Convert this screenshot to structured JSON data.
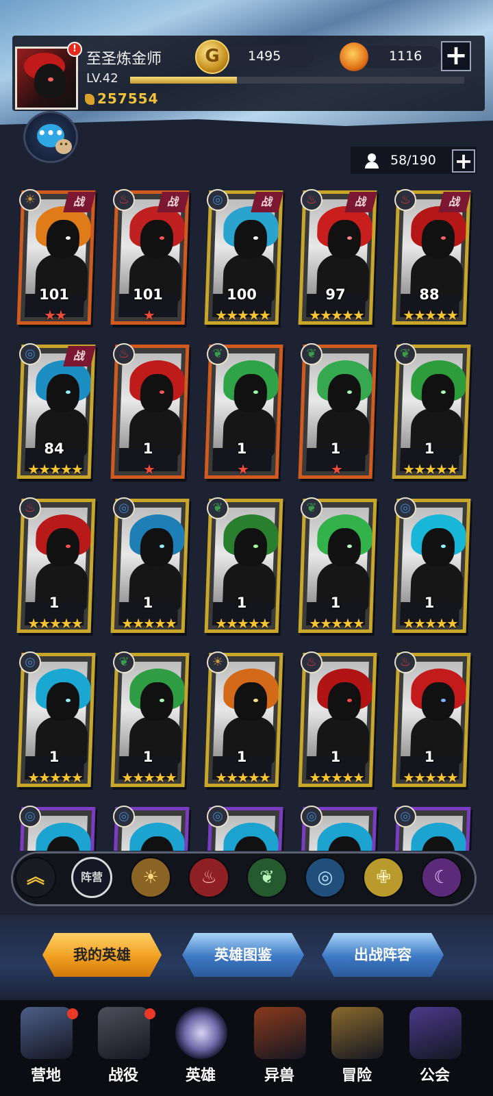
{
  "player": {
    "name": "至圣炼金师",
    "level": "LV.42",
    "power": "257554",
    "alert": "!",
    "xp_fraction": 0.32
  },
  "currency": {
    "gold_icon": "gold-coin-icon",
    "gold": "1495",
    "gem_icon": "fire-gem-icon",
    "gem": "1116",
    "add": "+"
  },
  "chat": {
    "icon": "chat-bubble-icon",
    "bubble": "•••",
    "small": "••"
  },
  "roster": {
    "count": "58/190",
    "add": "+"
  },
  "colors": {
    "gold_frame": "#c8a62a",
    "orange_frame": "#d15a1e",
    "purple_frame": "#7a3cc2",
    "star_gold": "#f6c531",
    "star_red": "#ef4d3c",
    "fight_tag": "#7b1730"
  },
  "heroes": [
    {
      "level": "101",
      "stars": "★★",
      "star_color": "red",
      "faction": "sun",
      "fight": "战",
      "frame": "orange",
      "hair": "#e07b1a",
      "eye": "#ffffff"
    },
    {
      "level": "101",
      "stars": "★",
      "star_color": "red",
      "faction": "fire",
      "fight": "战",
      "frame": "orange",
      "hair": "#c12020",
      "eye": "#ff5555"
    },
    {
      "level": "100",
      "stars": "★★★★★",
      "star_color": "gold",
      "faction": "water",
      "fight": "战",
      "frame": "gold",
      "hair": "#2aa3cf",
      "eye": "#ffffff"
    },
    {
      "level": "97",
      "stars": "★★★★★",
      "star_color": "gold",
      "faction": "fire",
      "fight": "战",
      "frame": "gold",
      "hair": "#c81e1e",
      "eye": "#ff8080"
    },
    {
      "level": "88",
      "stars": "★★★★★",
      "star_color": "gold",
      "faction": "fire",
      "fight": "战",
      "frame": "gold",
      "hair": "#b51616",
      "eye": "#ff6060"
    },
    {
      "level": "84",
      "stars": "★★★★★",
      "star_color": "gold",
      "faction": "water",
      "fight": "战",
      "frame": "gold",
      "hair": "#1d8ec2",
      "eye": "#8ff3ff"
    },
    {
      "level": "1",
      "stars": "★",
      "star_color": "red",
      "faction": "fire",
      "fight": "",
      "frame": "orange",
      "hair": "#c01b1b",
      "eye": "#ff5555"
    },
    {
      "level": "1",
      "stars": "★",
      "star_color": "red",
      "faction": "nature",
      "fight": "",
      "frame": "orange",
      "hair": "#2fa347",
      "eye": "#9dffa8"
    },
    {
      "level": "1",
      "stars": "★",
      "star_color": "red",
      "faction": "nature",
      "fight": "",
      "frame": "orange",
      "hair": "#36a850",
      "eye": "#a8ffb8"
    },
    {
      "level": "1",
      "stars": "★★★★★",
      "star_color": "gold",
      "faction": "nature",
      "fight": "",
      "frame": "gold",
      "hair": "#2c9c3c",
      "eye": "#b0ffb0"
    },
    {
      "level": "1",
      "stars": "★★★★★",
      "star_color": "gold",
      "faction": "fire",
      "fight": "",
      "frame": "gold",
      "hair": "#b81a1a",
      "eye": "#ff5050"
    },
    {
      "level": "1",
      "stars": "★★★★★",
      "star_color": "gold",
      "faction": "water",
      "fight": "",
      "frame": "gold",
      "hair": "#1d7fb5",
      "eye": "#8ef0ff"
    },
    {
      "level": "1",
      "stars": "★★★★★",
      "star_color": "gold",
      "faction": "nature",
      "fight": "",
      "frame": "gold",
      "hair": "#2a7f2f",
      "eye": "#a4ff9f"
    },
    {
      "level": "1",
      "stars": "★★★★★",
      "star_color": "gold",
      "faction": "nature",
      "fight": "",
      "frame": "gold",
      "hair": "#33b14b",
      "eye": "#b9ffc4"
    },
    {
      "level": "1",
      "stars": "★★★★★",
      "star_color": "gold",
      "faction": "water",
      "fight": "",
      "frame": "gold",
      "hair": "#18b7d8",
      "eye": "#8ff7ff"
    },
    {
      "level": "1",
      "stars": "★★★★★",
      "star_color": "gold",
      "faction": "water",
      "fight": "",
      "frame": "gold",
      "hair": "#1aa7d1",
      "eye": "#8ff3ff"
    },
    {
      "level": "1",
      "stars": "★★★★★",
      "star_color": "gold",
      "faction": "nature",
      "fight": "",
      "frame": "gold",
      "hair": "#2f9d43",
      "eye": "#a9ffb5"
    },
    {
      "level": "1",
      "stars": "★★★★★",
      "star_color": "gold",
      "faction": "sun",
      "fight": "",
      "frame": "gold",
      "hair": "#d36a1a",
      "eye": "#ffe08a"
    },
    {
      "level": "1",
      "stars": "★★★★★",
      "star_color": "gold",
      "faction": "fire",
      "fight": "",
      "frame": "gold",
      "hair": "#b11414",
      "eye": "#ff4a4a"
    },
    {
      "level": "1",
      "stars": "★★★★★",
      "star_color": "gold",
      "faction": "fire",
      "fight": "",
      "frame": "gold",
      "hair": "#c31b1b",
      "eye": "#7fb0ff"
    },
    {
      "level": "",
      "stars": "",
      "star_color": "gold",
      "faction": "water",
      "fight": "",
      "frame": "purple",
      "hair": "#1ca3d0",
      "eye": "#8ff3ff"
    },
    {
      "level": "",
      "stars": "",
      "star_color": "gold",
      "faction": "water",
      "fight": "",
      "frame": "purple",
      "hair": "#1ca3d0",
      "eye": "#8ff3ff"
    },
    {
      "level": "",
      "stars": "",
      "star_color": "gold",
      "faction": "water",
      "fight": "",
      "frame": "purple",
      "hair": "#1ca3d0",
      "eye": "#8ff3ff"
    },
    {
      "level": "",
      "stars": "",
      "star_color": "gold",
      "faction": "water",
      "fight": "",
      "frame": "purple",
      "hair": "#1ca3d0",
      "eye": "#8ff3ff"
    },
    {
      "level": "",
      "stars": "",
      "star_color": "gold",
      "faction": "water",
      "fight": "",
      "frame": "purple",
      "hair": "#1ca3d0",
      "eye": "#8ff3ff"
    }
  ],
  "faction_glyphs": {
    "sun": "☀",
    "fire": "♨",
    "water": "◎",
    "nature": "❦"
  },
  "filters": [
    {
      "icon": "collapse-chevron-icon",
      "glyph": "︽",
      "bg": "#1a1c24",
      "fg": "#f0c23b"
    },
    {
      "icon": "camp-all-icon",
      "label": "阵营",
      "bg": "#151824",
      "fg": "#d8d8d8"
    },
    {
      "icon": "sun-faction-icon",
      "glyph": "☀",
      "bg": "#8a6424",
      "fg": "#ffd880"
    },
    {
      "icon": "fire-faction-icon",
      "glyph": "♨",
      "bg": "#8e1f24",
      "fg": "#ffb3b3"
    },
    {
      "icon": "nature-faction-icon",
      "glyph": "❦",
      "bg": "#245a2e",
      "fg": "#b7f5b9"
    },
    {
      "icon": "water-faction-icon",
      "glyph": "◎",
      "bg": "#1f4f7a",
      "fg": "#bde3ff"
    },
    {
      "icon": "holy-faction-icon",
      "glyph": "✙",
      "bg": "#b99a2c",
      "fg": "#fff3c0"
    },
    {
      "icon": "void-faction-icon",
      "glyph": "☾",
      "bg": "#5b2b7a",
      "fg": "#e6c8ff"
    }
  ],
  "actions": [
    {
      "label": "我的英雄",
      "style": "primary"
    },
    {
      "label": "英雄图鉴",
      "style": "secondary"
    },
    {
      "label": "出战阵容",
      "style": "secondary"
    }
  ],
  "nav": [
    {
      "label": "营地",
      "icon": "camp-tower-icon",
      "color": "#4c5e88",
      "dot": true
    },
    {
      "label": "战役",
      "icon": "crossed-swords-icon",
      "color": "#4d4f5c",
      "dot": true
    },
    {
      "label": "英雄",
      "icon": "knight-helmet-icon",
      "color": "#3a3550",
      "dot": false,
      "active": true
    },
    {
      "label": "异兽",
      "icon": "beast-head-icon",
      "color": "#8a3a1c",
      "dot": false
    },
    {
      "label": "冒险",
      "icon": "compass-icon",
      "color": "#8a6a2c",
      "dot": false
    },
    {
      "label": "公会",
      "icon": "guild-banner-icon",
      "color": "#4b3a8a",
      "dot": false
    }
  ]
}
